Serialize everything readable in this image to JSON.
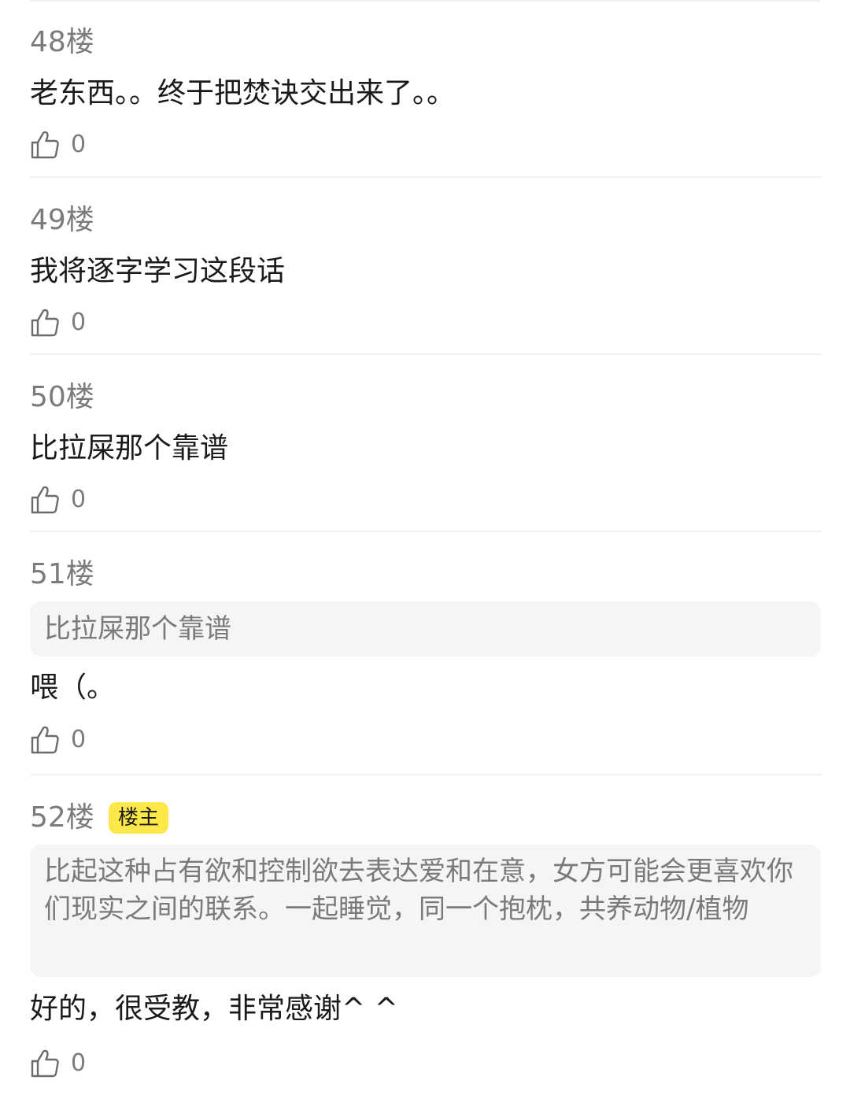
{
  "comments": [
    {
      "floor": "48楼",
      "text": "老东西。。终于把焚诀交出来了。。",
      "likes": "0"
    },
    {
      "floor": "49楼",
      "text": "我将逐字学习这段话",
      "likes": "0"
    },
    {
      "floor": "50楼",
      "text": "比拉屎那个靠谱",
      "likes": "0"
    },
    {
      "floor": "51楼",
      "quote": "比拉屎那个靠谱",
      "text": "喂（。",
      "likes": "0"
    },
    {
      "floor": "52楼",
      "badge": "楼主",
      "quote": "比起这种占有欲和控制欲去表达爱和在意，女方可能会更喜欢你们现实之间的联系。一起睡觉，同一个抱枕，共养动物/植物",
      "text": "好的，很受教，非常感谢^ ^",
      "likes": "0"
    }
  ],
  "colors": {
    "badge_bg": "#fde84a",
    "quote_bg": "#f5f5f5",
    "divider": "#f1f1f1"
  },
  "icons": {
    "like": "thumbs-up-outline-icon"
  }
}
